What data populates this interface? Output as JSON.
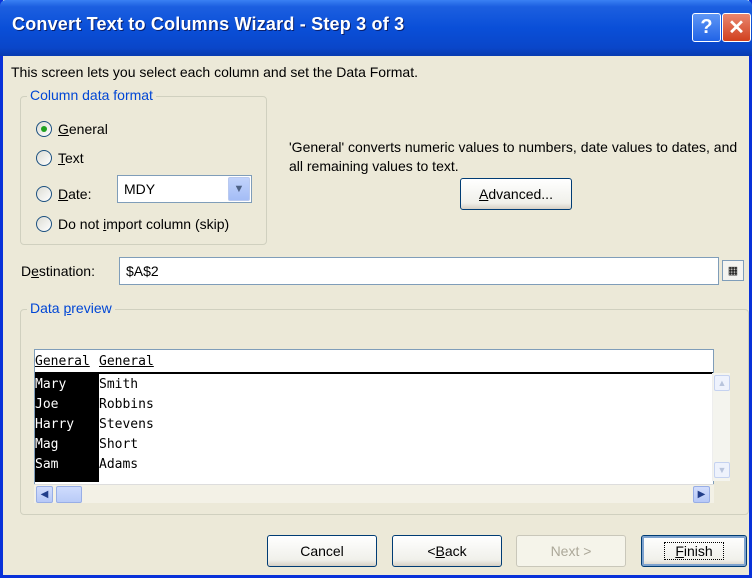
{
  "window": {
    "title": "Convert Text to Columns Wizard - Step 3 of 3"
  },
  "description": "This screen lets you select each column and set the Data Format.",
  "format_group": {
    "legend": "Column data format",
    "options": [
      {
        "label_pre": "",
        "label_u": "G",
        "label_post": "eneral",
        "selected": true
      },
      {
        "label_pre": "",
        "label_u": "T",
        "label_post": "ext",
        "selected": false
      },
      {
        "label_pre": "",
        "label_u": "D",
        "label_post": "ate:",
        "selected": false
      },
      {
        "label_pre": "Do not ",
        "label_u": "i",
        "label_post": "mport column (skip)",
        "selected": false
      }
    ],
    "date_format": "MDY"
  },
  "note": "'General' converts numeric values to numbers, date values to dates, and all remaining values to text.",
  "advanced_button": {
    "pre": "",
    "u": "A",
    "post": "dvanced..."
  },
  "destination": {
    "label_pre": "D",
    "label_u": "e",
    "label_post": "stination:",
    "value": "$A$2"
  },
  "preview": {
    "legend_pre": "Data ",
    "legend_u": "p",
    "legend_post": "review",
    "headers": [
      "General",
      "General"
    ],
    "rows": [
      [
        "Mary",
        "Smith"
      ],
      [
        "Joe",
        "Robbins"
      ],
      [
        "Harry",
        "Stevens"
      ],
      [
        "Mag",
        "Short"
      ],
      [
        "Sam",
        "Adams"
      ]
    ]
  },
  "buttons": {
    "cancel": "Cancel",
    "back_pre": "< ",
    "back_u": "B",
    "back_post": "ack",
    "next": "Next >",
    "finish_u": "F",
    "finish_post": "inish"
  }
}
